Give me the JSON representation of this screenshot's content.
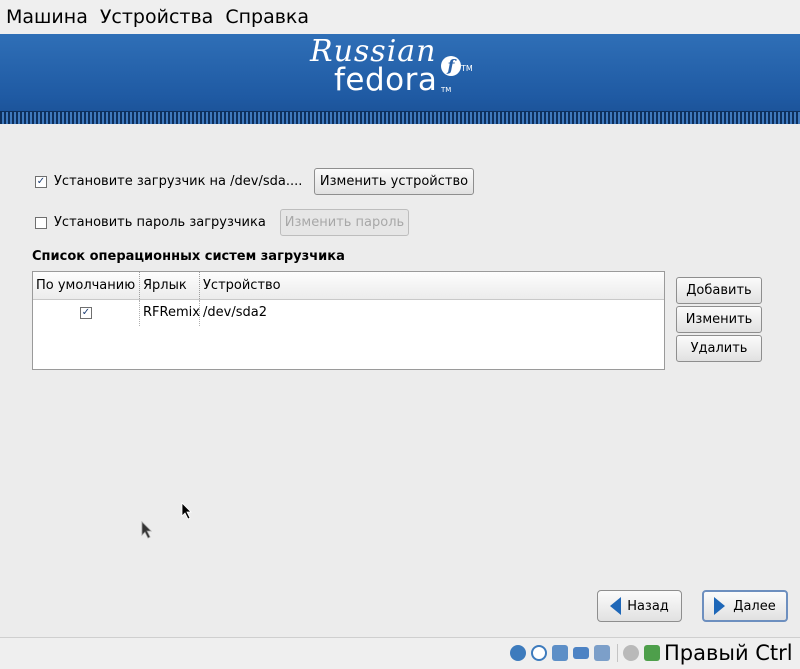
{
  "menubar": {
    "items": [
      "Машина",
      "Устройства",
      "Справка"
    ]
  },
  "banner": {
    "logo_line1": "Russian",
    "logo_line2": "fedora",
    "logo_badge": "f",
    "tm": "TM"
  },
  "options": {
    "install_loader": {
      "label": "Установите загрузчик на /dev/sda....",
      "checked": true,
      "button": "Изменить устройство"
    },
    "loader_password": {
      "label": "Установить пароль загрузчика",
      "checked": false,
      "button": "Изменить пароль"
    }
  },
  "os_list": {
    "title": "Список операционных систем загрузчика",
    "columns": [
      "По умолчанию",
      "Ярлык",
      "Устройство"
    ],
    "rows": [
      {
        "default": true,
        "label": "RFRemix",
        "device": "/dev/sda2"
      }
    ],
    "buttons": {
      "add": "Добавить",
      "edit": "Изменить",
      "delete": "Удалить"
    }
  },
  "nav": {
    "back": "Назад",
    "next": "Далее"
  },
  "statusbar": {
    "host_key": "Правый Ctrl",
    "icons": [
      "hard-disk-icon",
      "optical-disc-icon",
      "network-icon",
      "shared-folder-icon",
      "usb-icon",
      "mouse-integration-icon",
      "host-key-arrow-icon"
    ]
  },
  "colors": {
    "banner_blue": "#1f5aa3",
    "accent_arrow": "#1e67b8"
  }
}
